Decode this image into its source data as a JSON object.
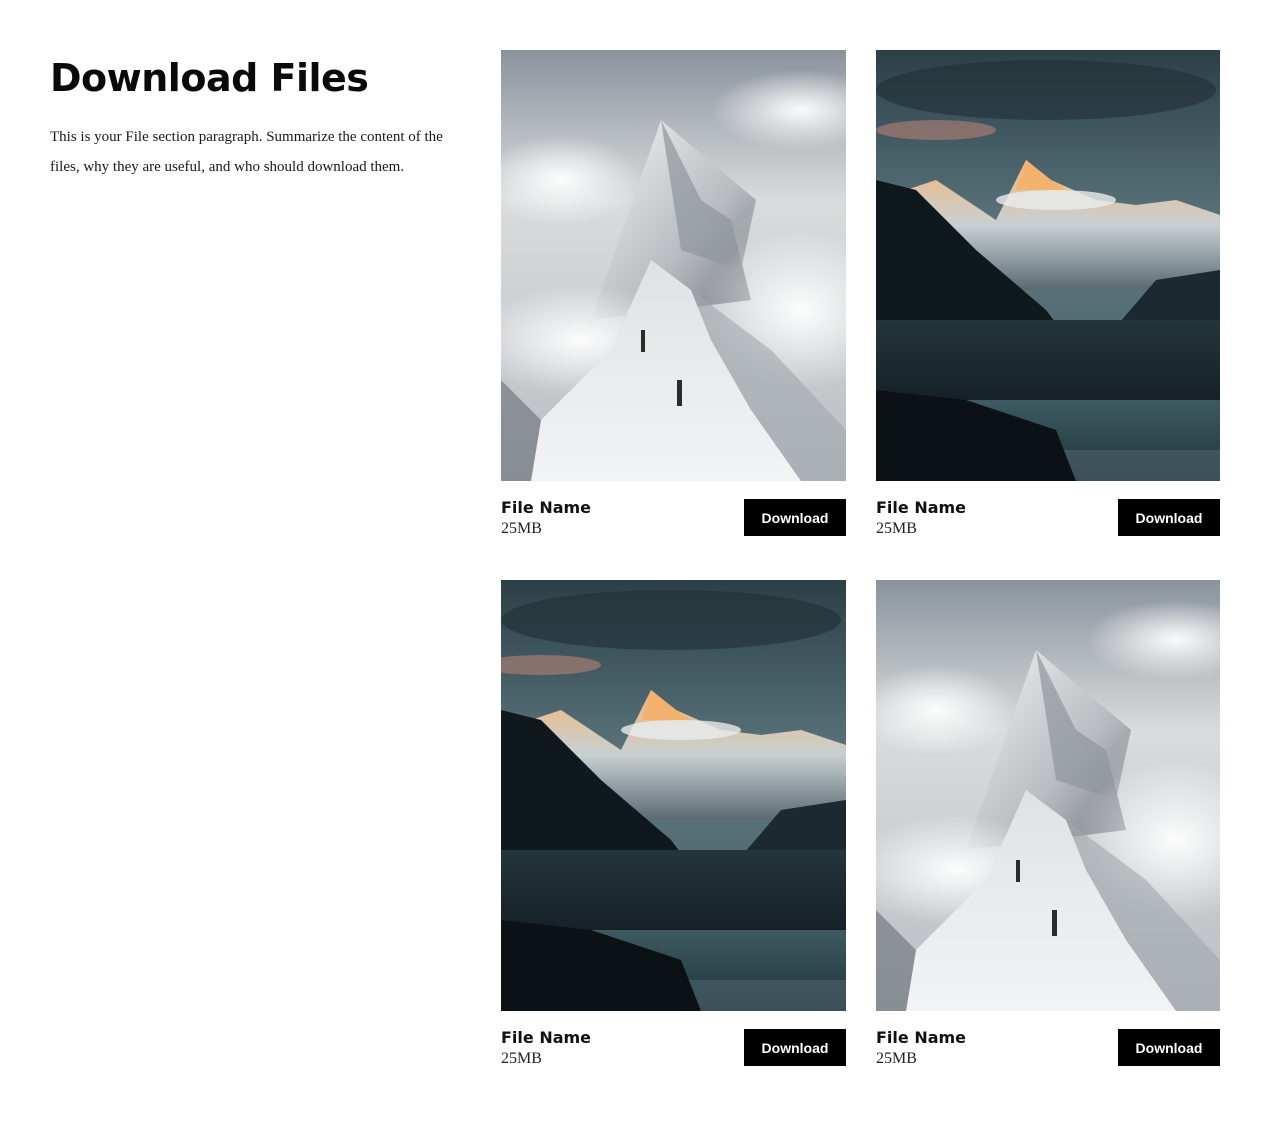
{
  "header": {
    "title": "Download Files",
    "paragraph": "This is your File section paragraph. Summarize the content of the files, why they are useful, and who should download them."
  },
  "files": [
    {
      "name": "File Name",
      "size": "25MB",
      "button_label": "Download",
      "image": "mountain-ridge-climbers"
    },
    {
      "name": "File Name",
      "size": "25MB",
      "button_label": "Download",
      "image": "alpine-glacier-sunset"
    },
    {
      "name": "File Name",
      "size": "25MB",
      "button_label": "Download",
      "image": "alpine-glacier-sunset"
    },
    {
      "name": "File Name",
      "size": "25MB",
      "button_label": "Download",
      "image": "mountain-ridge-climbers"
    }
  ],
  "colors": {
    "button_bg": "#000000",
    "button_text": "#ffffff",
    "page_bg": "#ffffff"
  }
}
